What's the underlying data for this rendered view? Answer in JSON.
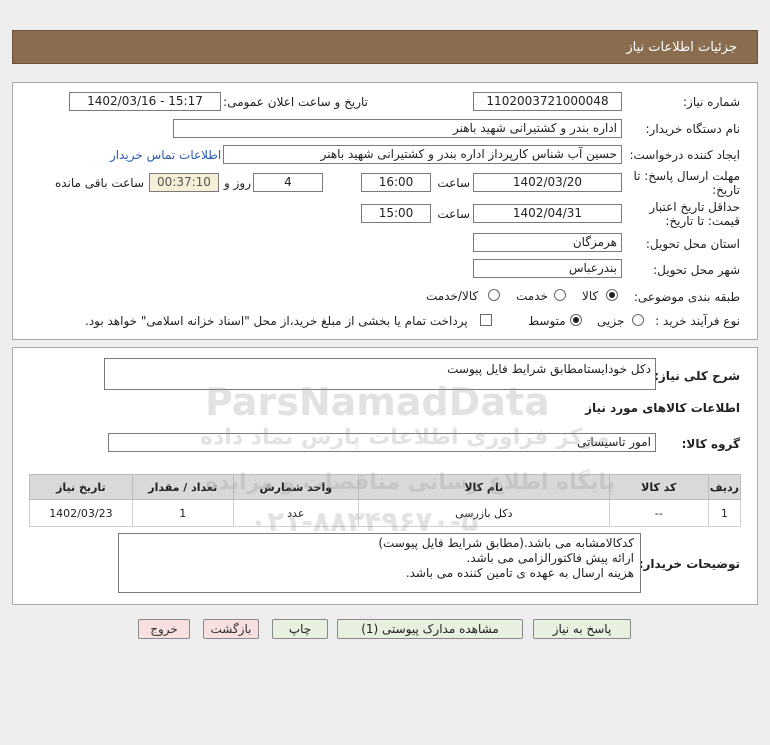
{
  "window": {
    "title": "جزئیات اطلاعات نیاز"
  },
  "form": {
    "need_number_label": "شماره نیاز:",
    "need_number": "1102003721000048",
    "announce_label": "تاریخ و ساعت اعلان عمومی:",
    "announce_value": "1402/03/16 - 15:17",
    "buyer_org_label": "نام دستگاه خریدار:",
    "buyer_org": "اداره بندر و کشتیرانی شهید باهنر",
    "creator_label": "ایجاد کننده درخواست:",
    "creator": "حسین آب شناس کارپرداز اداره بندر و کشتیرانی شهید باهنر",
    "contact_link": "اطلاعات تماس خریدار",
    "deadline_label_1": "مهلت ارسال پاسخ: تا",
    "deadline_label_2": "تاریخ:",
    "deadline_date": "1402/03/20",
    "time_label": "ساعت",
    "deadline_time": "16:00",
    "days_value": "4",
    "days_label": "روز و",
    "remaining_value": "00:37:10",
    "remaining_label": "ساعت باقی مانده",
    "validity_label_1": "حداقل تاریخ اعتبار",
    "validity_label_2": "قیمت: تا تاریخ:",
    "validity_date": "1402/04/31",
    "validity_time": "15:00",
    "province_label": "استان محل تحویل:",
    "province": "هرمزگان",
    "city_label": "شهر محل تحویل:",
    "city": "بندرعباس",
    "category_label": "طبقه بندی موضوعی:",
    "category_options": [
      "کالا",
      "خدمت",
      "کالا/خدمت"
    ],
    "category_selected": "کالا",
    "process_label": "نوع فرآیند خرید :",
    "process_options": [
      "جزیی",
      "متوسط"
    ],
    "process_selected": "متوسط",
    "payment_note": "پرداخت تمام یا بخشی از مبلغ خرید،از محل \"اسناد خزانه اسلامی\" خواهد بود."
  },
  "description": {
    "label": "شرح کلی نیاز:",
    "value": "دکل خودایستامطابق شرایط فایل پیوست",
    "goods_info_heading": "اطلاعات کالاهای مورد نیاز",
    "group_label": "گروه کالا:",
    "group_value": "امور تاسیساتی"
  },
  "table": {
    "headers": [
      "ردیف",
      "کد کالا",
      "نام کالا",
      "واحد شمارش",
      "تعداد / مقدار",
      "تاریخ نیاز"
    ],
    "rows": [
      [
        "1",
        "--",
        "دکل بازرسی",
        "عدد",
        "1",
        "1402/03/23"
      ]
    ]
  },
  "buyer_notes": {
    "label": "توضیحات خریدار:",
    "lines": [
      "کدکالامشابه می باشد.(مطابق شرایط فایل پیوست)",
      "ارائه پیش فاکتورالزامی می باشد.",
      "هزینه ارسال به عهده ی تامین کننده می باشد."
    ]
  },
  "buttons": {
    "reply": "پاسخ به نیاز",
    "attachments": "مشاهده مدارک پیوستی (1)",
    "print": "چاپ",
    "back": "بازگشت",
    "exit": "خروج"
  },
  "watermark": {
    "brand": "ParsNamadData",
    "line1": "مرکز فراوری اطلاعات پارس نماد داده",
    "line2": "پایگاه اطلاع رسانی مناقصات و مزایده",
    "phone": "۰۲۱-۸۸۳۴۹۶۷۰-۵"
  },
  "colors": {
    "title_bar": "#8a6d4e",
    "link": "#2a5db0",
    "remaining_bg": "#f5efd7"
  }
}
